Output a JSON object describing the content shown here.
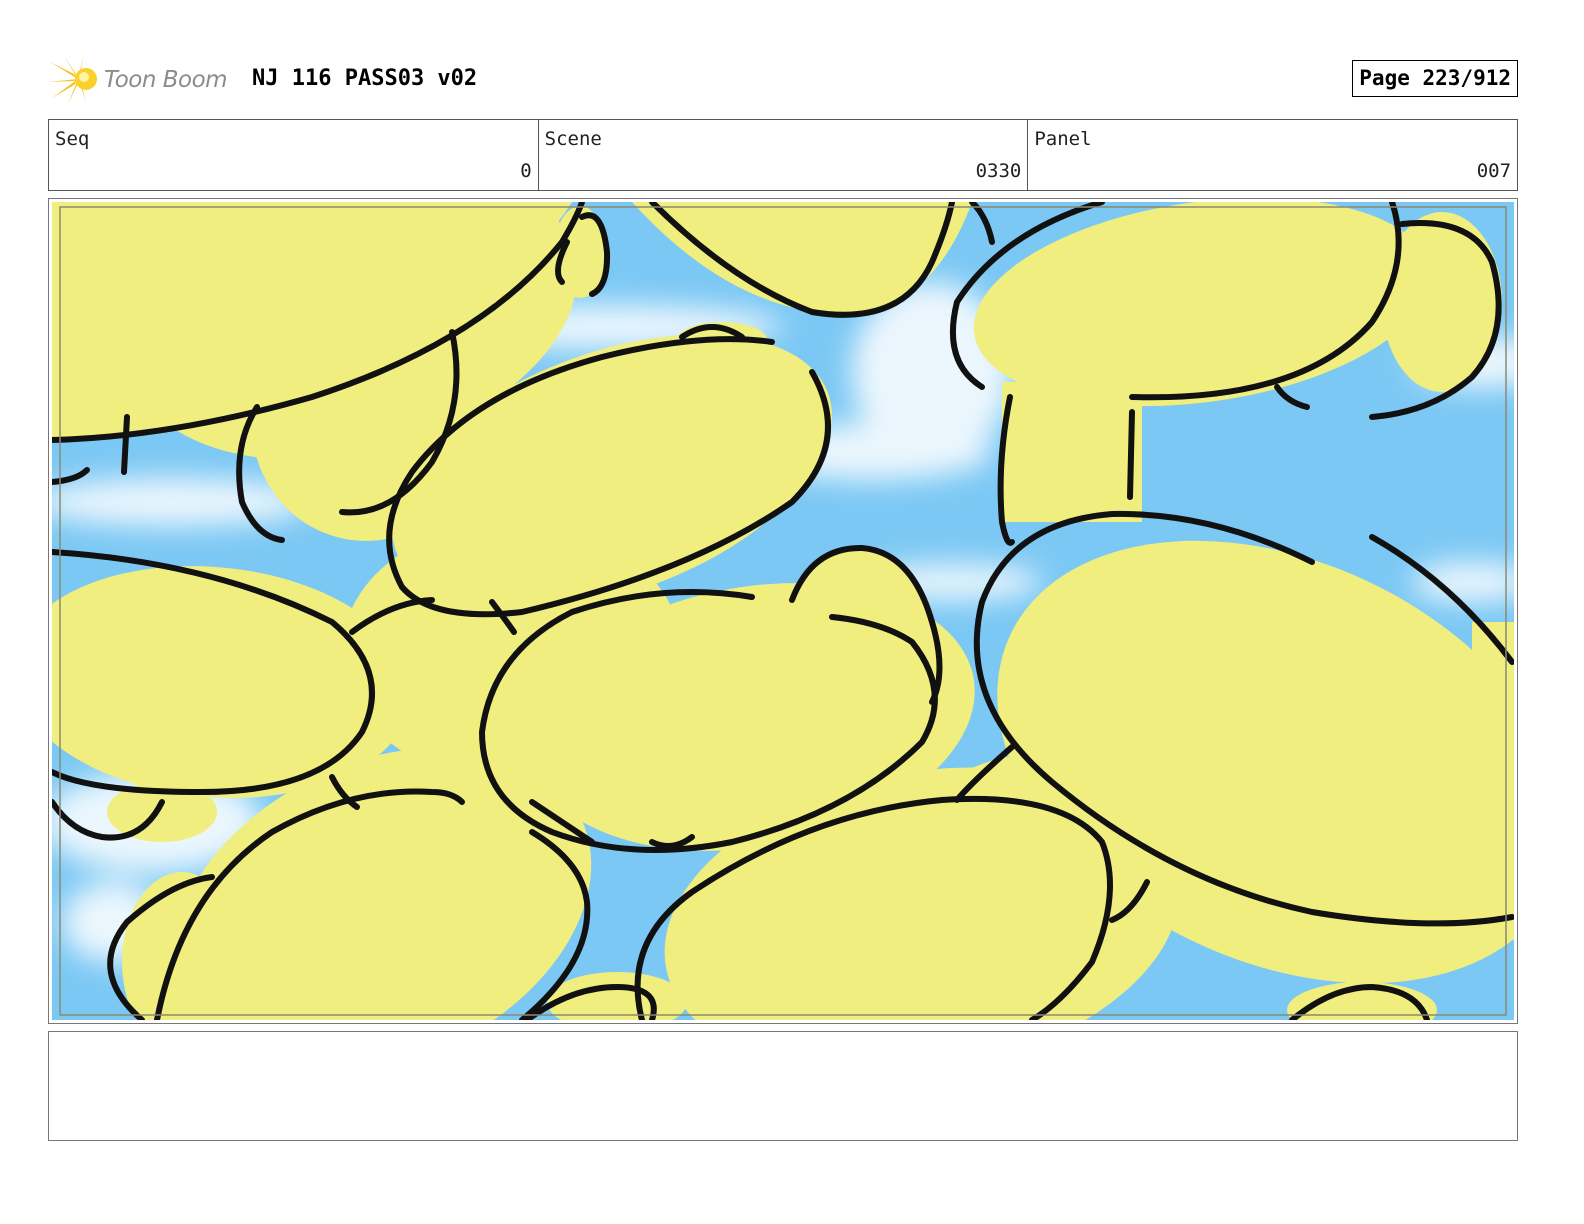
{
  "header": {
    "logo_text": "Toon Boom",
    "logo_icon": "starburst-logo-icon",
    "title": "NJ 116 PASS03 v02",
    "page_label": "Page 223/912"
  },
  "info": {
    "seq_label": "Seq",
    "seq_value": "0",
    "scene_label": "Scene",
    "scene_value": "0330",
    "panel_label": "Panel",
    "panel_value": "007"
  },
  "panel_image": {
    "description_icon": "storyboard-drawing",
    "colors": {
      "sky": "#7cc8f4",
      "cloud": "#ffffff",
      "blob_fill": "#f0ee7e",
      "outline": "#111111"
    }
  },
  "notes": {
    "text": ""
  }
}
